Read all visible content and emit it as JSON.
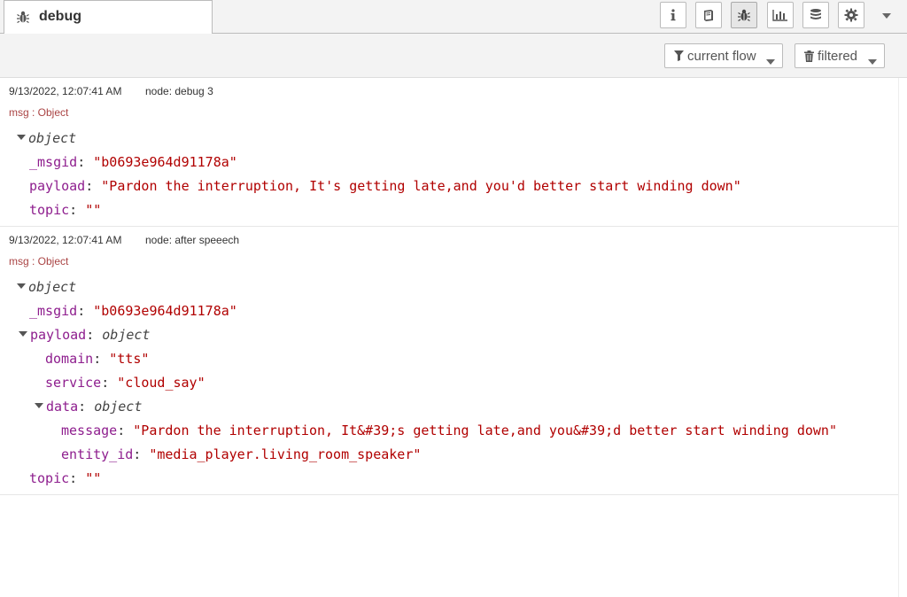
{
  "tab": {
    "title": "debug",
    "icon": "bug-icon"
  },
  "toolbar": {
    "buttons": [
      {
        "name": "info-button",
        "icon": "info-icon"
      },
      {
        "name": "help-button",
        "icon": "book-icon"
      },
      {
        "name": "debug-button",
        "icon": "bug-icon",
        "selected": true
      },
      {
        "name": "dashboard-button",
        "icon": "chart-icon"
      },
      {
        "name": "context-button",
        "icon": "database-icon"
      },
      {
        "name": "config-button",
        "icon": "gear-icon"
      }
    ]
  },
  "filters": {
    "flow_label": "current flow",
    "filter_label": "filtered"
  },
  "messages": [
    {
      "date": "9/13/2022, 12:07:41 AM",
      "node": "node: debug 3",
      "type": "msg : Object",
      "root": "object",
      "msgid_key": "_msgid",
      "msgid_val": "\"b0693e964d91178a\"",
      "payload_key": "payload",
      "payload_val": "\"Pardon the interruption, It's getting late,and you'd better start winding down\"",
      "topic_key": "topic",
      "topic_val": "\"\""
    },
    {
      "date": "9/13/2022, 12:07:41 AM",
      "node": "node: after speeech",
      "type": "msg : Object",
      "root": "object",
      "msgid_key": "_msgid",
      "msgid_val": "\"b0693e964d91178a\"",
      "payload_key": "payload",
      "payload_type": "object",
      "domain_key": "domain",
      "domain_val": "\"tts\"",
      "service_key": "service",
      "service_val": "\"cloud_say\"",
      "data_key": "data",
      "data_type": "object",
      "message_key": "message",
      "message_val": "\"Pardon the interruption, It&#39;s getting late,and you&#39;d better start winding down\"",
      "entity_key": "entity_id",
      "entity_val": "\"media_player.living_room_speaker\"",
      "topic_key": "topic",
      "topic_val": "\"\""
    }
  ]
}
